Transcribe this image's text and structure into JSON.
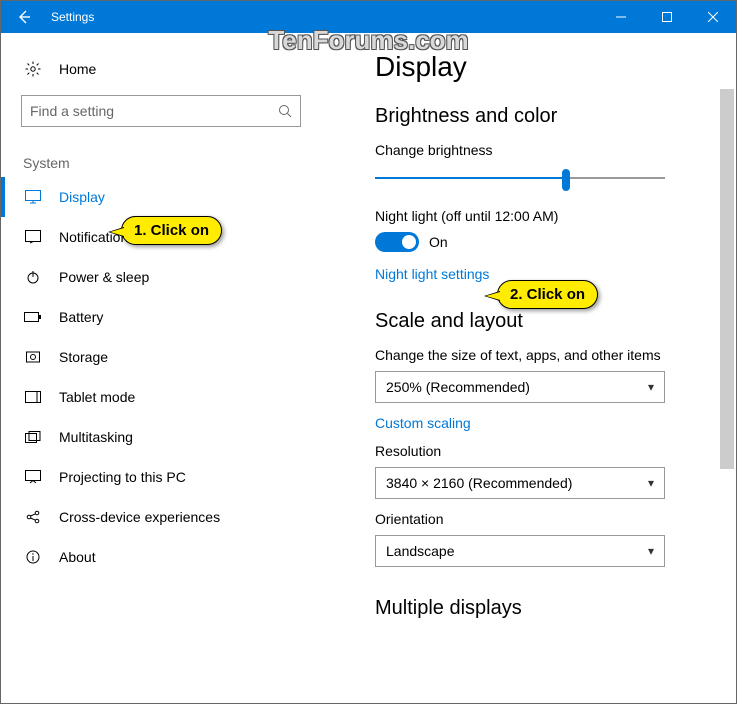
{
  "titlebar": {
    "title": "Settings"
  },
  "watermark": "TenForums.com",
  "sidebar": {
    "home": "Home",
    "search_placeholder": "Find a setting",
    "category": "System",
    "items": [
      {
        "label": "Display"
      },
      {
        "label": "Notifications & actions"
      },
      {
        "label": "Power & sleep"
      },
      {
        "label": "Battery"
      },
      {
        "label": "Storage"
      },
      {
        "label": "Tablet mode"
      },
      {
        "label": "Multitasking"
      },
      {
        "label": "Projecting to this PC"
      },
      {
        "label": "Cross-device experiences"
      },
      {
        "label": "About"
      }
    ]
  },
  "main": {
    "heading": "Display",
    "brightness_section": "Brightness and color",
    "brightness_label": "Change brightness",
    "brightness_value_pct": 66,
    "night_light_label": "Night light (off until 12:00 AM)",
    "night_light_state": "On",
    "night_light_link": "Night light settings",
    "scale_section": "Scale and layout",
    "scale_label": "Change the size of text, apps, and other items",
    "scale_value": "250% (Recommended)",
    "custom_scaling_link": "Custom scaling",
    "resolution_label": "Resolution",
    "resolution_value": "3840 × 2160 (Recommended)",
    "orientation_label": "Orientation",
    "orientation_value": "Landscape",
    "multiple_section": "Multiple displays"
  },
  "callouts": {
    "c1": "1. Click on",
    "c2": "2. Click on"
  }
}
